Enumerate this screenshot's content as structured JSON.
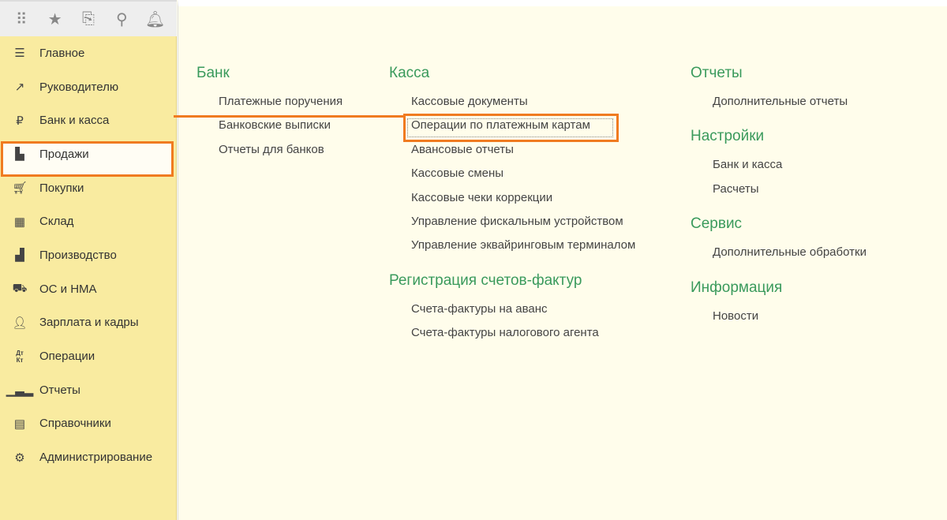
{
  "toolbar": {
    "icons": [
      "apps-grid-icon",
      "favorites-star-icon",
      "history-icon",
      "search-icon",
      "notifications-bell-icon"
    ]
  },
  "sidebar": {
    "items": [
      {
        "label": "Главное",
        "icon": "menu-icon"
      },
      {
        "label": "Руководителю",
        "icon": "trend-icon"
      },
      {
        "label": "Банк и касса",
        "icon": "ruble-icon"
      },
      {
        "label": "Продажи",
        "icon": "bag-icon"
      },
      {
        "label": "Покупки",
        "icon": "cart-icon"
      },
      {
        "label": "Склад",
        "icon": "warehouse-icon"
      },
      {
        "label": "Производство",
        "icon": "factory-icon"
      },
      {
        "label": "ОС и НМА",
        "icon": "truck-icon"
      },
      {
        "label": "Зарплата и кадры",
        "icon": "person-icon"
      },
      {
        "label": "Операции",
        "icon": "dt-kt-icon"
      },
      {
        "label": "Отчеты",
        "icon": "bar-chart-icon"
      },
      {
        "label": "Справочники",
        "icon": "books-icon"
      },
      {
        "label": "Администрирование",
        "icon": "gear-icon"
      }
    ],
    "selected": "Банк и касса"
  },
  "sections": {
    "bank": {
      "title": "Банк",
      "links": [
        "Платежные поручения",
        "Банковские выписки",
        "Отчеты для банков"
      ]
    },
    "kassa": {
      "title": "Касса",
      "links": [
        "Кассовые документы",
        "Операции по платежным картам",
        "Авансовые отчеты",
        "Кассовые смены",
        "Кассовые чеки коррекции",
        "Управление фискальным устройством",
        "Управление эквайринговым терминалом"
      ]
    },
    "invoices": {
      "title": "Регистрация счетов-фактур",
      "links": [
        "Счета-фактуры на аванс",
        "Счета-фактуры налогового агента"
      ]
    },
    "reports": {
      "title": "Отчеты",
      "links": [
        "Дополнительные отчеты"
      ]
    },
    "settings": {
      "title": "Настройки",
      "links": [
        "Банк и касса",
        "Расчеты"
      ]
    },
    "service": {
      "title": "Сервис",
      "links": [
        "Дополнительные обработки"
      ]
    },
    "info": {
      "title": "Информация",
      "links": [
        "Новости"
      ]
    }
  },
  "colors": {
    "highlight": "#f07b20",
    "group_title": "#3a9a5c",
    "sidebar": "#f9eba0"
  }
}
